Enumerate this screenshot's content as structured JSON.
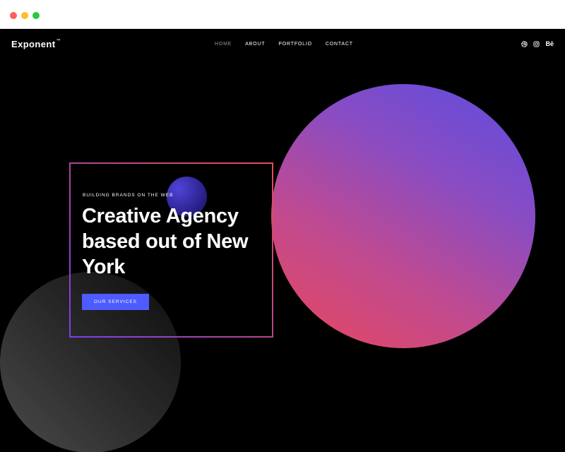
{
  "window": {
    "controls": [
      "close",
      "minimize",
      "zoom"
    ]
  },
  "header": {
    "logo": "Exponent",
    "logo_mark": "™",
    "nav": [
      {
        "label": "HOME",
        "active": true
      },
      {
        "label": "ABOUT",
        "active": false
      },
      {
        "label": "PORTFOLIO",
        "active": false
      },
      {
        "label": "CONTACT",
        "active": false
      }
    ],
    "social": [
      {
        "icon": "dribbble-icon"
      },
      {
        "icon": "instagram-icon"
      },
      {
        "icon": "behance-icon",
        "label": "Bē"
      }
    ]
  },
  "hero": {
    "eyebrow": "BUILDING BRANDS ON THE WEB",
    "headline": "Creative Agency based out of New York",
    "cta_label": "OUR SERVICES"
  },
  "colors": {
    "background": "#000000",
    "accent": "#4d5bff",
    "gradient_start": "#e8475c",
    "gradient_end": "#5b4ce0"
  }
}
